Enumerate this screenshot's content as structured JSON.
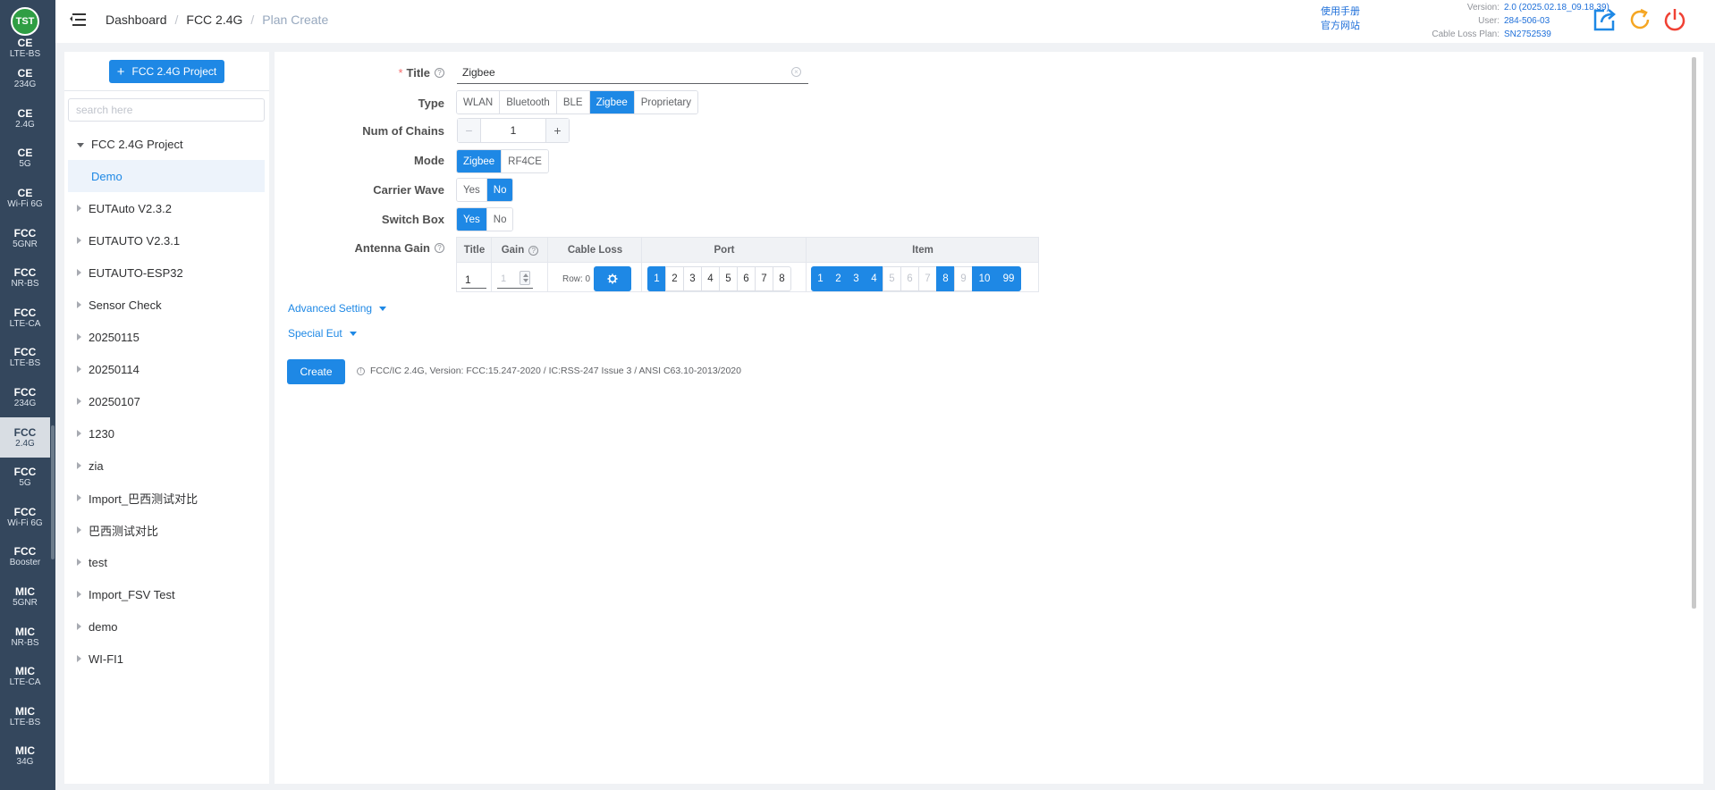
{
  "logo": {
    "text": "TST"
  },
  "leftnav": {
    "items": [
      {
        "a": "CE",
        "b": "LTE-BS",
        "active": false
      },
      {
        "a": "CE",
        "b": "234G",
        "active": false
      },
      {
        "a": "CE",
        "b": "2.4G",
        "active": false
      },
      {
        "a": "CE",
        "b": "5G",
        "active": false
      },
      {
        "a": "CE",
        "b": "Wi-Fi 6G",
        "active": false
      },
      {
        "a": "FCC",
        "b": "5GNR",
        "active": false
      },
      {
        "a": "FCC",
        "b": "NR-BS",
        "active": false
      },
      {
        "a": "FCC",
        "b": "LTE-CA",
        "active": false
      },
      {
        "a": "FCC",
        "b": "LTE-BS",
        "active": false
      },
      {
        "a": "FCC",
        "b": "234G",
        "active": false
      },
      {
        "a": "FCC",
        "b": "2.4G",
        "active": true
      },
      {
        "a": "FCC",
        "b": "5G",
        "active": false
      },
      {
        "a": "FCC",
        "b": "Wi-Fi 6G",
        "active": false
      },
      {
        "a": "FCC",
        "b": "Booster",
        "active": false
      },
      {
        "a": "MIC",
        "b": "5GNR",
        "active": false
      },
      {
        "a": "MIC",
        "b": "NR-BS",
        "active": false
      },
      {
        "a": "MIC",
        "b": "LTE-CA",
        "active": false
      },
      {
        "a": "MIC",
        "b": "LTE-BS",
        "active": false
      },
      {
        "a": "MIC",
        "b": "34G",
        "active": false
      }
    ]
  },
  "header": {
    "breadcrumb": [
      "Dashboard",
      "FCC 2.4G",
      "Plan Create"
    ],
    "links": [
      "使用手册",
      "官方网站"
    ],
    "info": [
      {
        "k": "Version:",
        "v": "2.0 (2025.02.18_09.18.39)"
      },
      {
        "k": "User:",
        "v": "284-506-03"
      },
      {
        "k": "Cable Loss Plan:",
        "v": "SN2752539"
      }
    ],
    "icons": [
      "export-icon",
      "refresh-icon",
      "power-icon"
    ]
  },
  "sidebar": {
    "add_button": "FCC 2.4G Project",
    "search_placeholder": "search here",
    "tree": [
      {
        "label": "FCC 2.4G Project",
        "expanded": true
      },
      {
        "label": "Demo",
        "child": true
      },
      {
        "label": "EUTAuto V2.3.2"
      },
      {
        "label": "EUTAUTO V2.3.1"
      },
      {
        "label": "EUTAUTO-ESP32"
      },
      {
        "label": "Sensor Check"
      },
      {
        "label": "20250115"
      },
      {
        "label": "20250114"
      },
      {
        "label": "20250107"
      },
      {
        "label": "1230"
      },
      {
        "label": "zia"
      },
      {
        "label": "Import_巴西测试对比"
      },
      {
        "label": "巴西测试对比"
      },
      {
        "label": "test"
      },
      {
        "label": "Import_FSV Test"
      },
      {
        "label": "demo"
      },
      {
        "label": "WI-FI1"
      }
    ]
  },
  "form": {
    "title_label": "Title",
    "title_value": "Zigbee",
    "type_label": "Type",
    "type_options": [
      "WLAN",
      "Bluetooth",
      "BLE",
      "Zigbee",
      "Proprietary"
    ],
    "type_selected": "Zigbee",
    "chains_label": "Num of Chains",
    "chains_value": "1",
    "mode_label": "Mode",
    "mode_options": [
      "Zigbee",
      "RF4CE"
    ],
    "mode_selected": "Zigbee",
    "carrier_label": "Carrier Wave",
    "carrier_options": [
      "Yes",
      "No"
    ],
    "carrier_selected": "No",
    "switch_label": "Switch Box",
    "switch_options": [
      "Yes",
      "No"
    ],
    "switch_selected": "Yes",
    "antenna_label": "Antenna Gain",
    "antenna": {
      "headers": {
        "title": "Title",
        "gain": "Gain",
        "cable_loss": "Cable Loss",
        "port": "Port",
        "item": "Item"
      },
      "title_value": "1",
      "gain_value": "1",
      "row_label": "Row: 0",
      "ports": [
        {
          "n": "1",
          "state": "on"
        },
        {
          "n": "2",
          "state": "normal"
        },
        {
          "n": "3",
          "state": "normal"
        },
        {
          "n": "4",
          "state": "normal"
        },
        {
          "n": "5",
          "state": "normal"
        },
        {
          "n": "6",
          "state": "normal"
        },
        {
          "n": "7",
          "state": "normal"
        },
        {
          "n": "8",
          "state": "normal"
        }
      ],
      "items": [
        {
          "n": "1",
          "state": "on"
        },
        {
          "n": "2",
          "state": "on"
        },
        {
          "n": "3",
          "state": "on"
        },
        {
          "n": "4",
          "state": "on"
        },
        {
          "n": "5",
          "state": "off"
        },
        {
          "n": "6",
          "state": "off"
        },
        {
          "n": "7",
          "state": "off"
        },
        {
          "n": "8",
          "state": "on"
        },
        {
          "n": "9",
          "state": "off"
        },
        {
          "n": "10",
          "state": "on"
        },
        {
          "n": "99",
          "state": "on"
        }
      ]
    },
    "advanced_setting": "Advanced Setting",
    "special_eut": "Special Eut",
    "create_button": "Create",
    "version_note": "FCC/IC 2.4G, Version: FCC:15.247-2020 / IC:RSS-247 Issue 3 / ANSI C63.10-2013/2020"
  }
}
